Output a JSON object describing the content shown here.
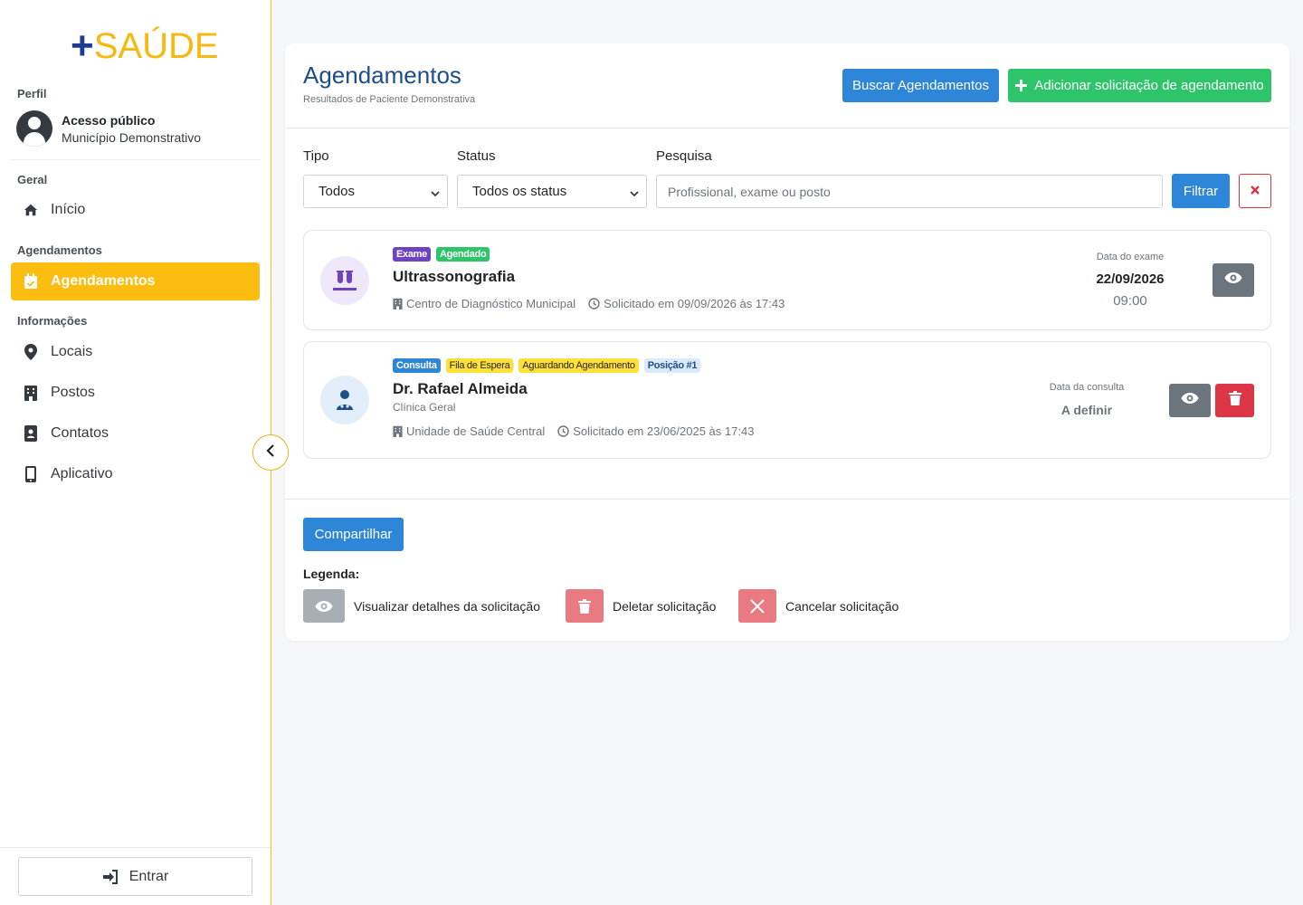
{
  "brand": {
    "plus": "+",
    "name": "SAÚDE"
  },
  "sidebar": {
    "profile_label": "Perfil",
    "profile_name": "Acesso público",
    "profile_sub": "Município Demonstrativo",
    "sections": {
      "geral": "Geral",
      "agendamentos": "Agendamentos",
      "informacoes": "Informações"
    },
    "items": {
      "inicio": "Início",
      "agendamentos": "Agendamentos",
      "locais": "Locais",
      "postos": "Postos",
      "contatos": "Contatos",
      "aplicativo": "Aplicativo"
    },
    "login_label": "Entrar"
  },
  "header": {
    "title": "Agendamentos",
    "subtitle": "Resultados de Paciente Demonstrativa",
    "search_button": "Buscar Agendamentos",
    "add_button": "Adicionar solicitação de agendamento"
  },
  "filters": {
    "tipo_label": "Tipo",
    "tipo_value": "Todos",
    "status_label": "Status",
    "status_value": "Todos os status",
    "search_label": "Pesquisa",
    "search_placeholder": "Profissional, exame ou posto",
    "filter_button": "Filtrar"
  },
  "appointments": [
    {
      "badges": [
        "Exame",
        "Agendado"
      ],
      "title": "Ultrassonografia",
      "location": "Centro de Diagnóstico Municipal",
      "requested": "Solicitado em 09/09/2026 às 17:43",
      "date_label": "Data do exame",
      "date": "22/09/2026",
      "time": "09:00"
    },
    {
      "badges": [
        "Consulta",
        "Fila de Espera",
        "Aguardando Agendamento",
        "Posição #1"
      ],
      "title": "Dr. Rafael Almeida",
      "specialty": "Clínica Geral",
      "location": "Unidade de Saúde Central",
      "requested": "Solicitado em 23/06/2025 às 17:43",
      "date_label": "Data da consulta",
      "date": "A definir"
    }
  ],
  "footer": {
    "share_button": "Compartilhar",
    "legend_title": "Legenda:",
    "legend": [
      "Visualizar detalhes da solicitação",
      "Deletar solicitação",
      "Cancelar solicitação"
    ]
  },
  "colors": {
    "brand_blue": "#1f3a93",
    "brand_yellow": "#f6b90f",
    "primary": "#2e86d9",
    "success": "#2ec56a",
    "danger": "#dc3545",
    "secondary": "#6c757d"
  },
  "icons": [
    "home-icon",
    "calendar-check-icon",
    "map-pin-icon",
    "building-icon",
    "contact-card-icon",
    "mobile-icon",
    "sign-in-icon",
    "chevron-left-icon",
    "eye-icon",
    "trash-icon",
    "close-icon",
    "plus-icon",
    "vials-icon",
    "doctor-icon",
    "clock-icon"
  ]
}
